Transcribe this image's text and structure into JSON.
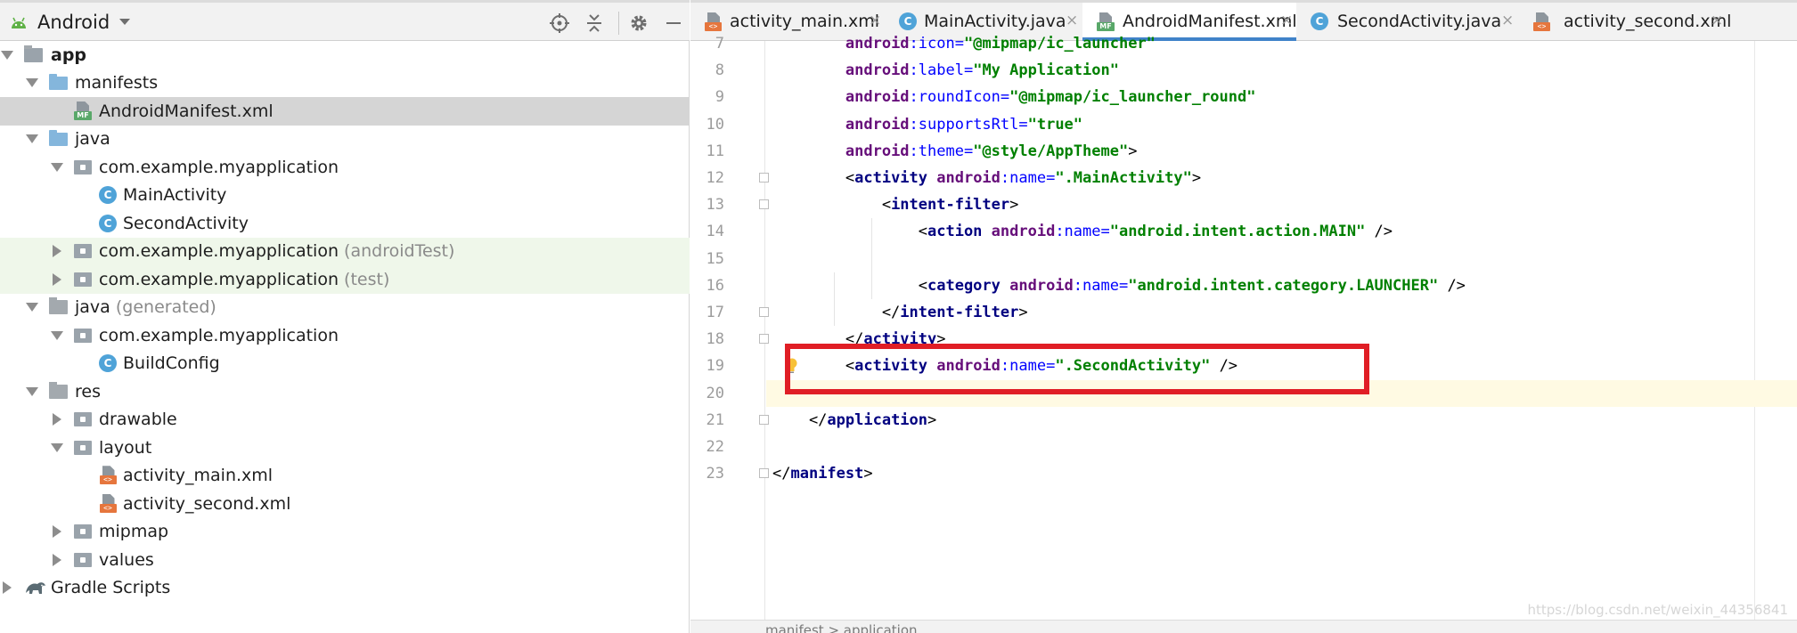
{
  "project_panel": {
    "view_mode": "Android",
    "header_icons": [
      "locate-icon",
      "collapse-all-icon",
      "gear-icon",
      "hide-icon"
    ],
    "tree": [
      {
        "label": "app",
        "bold": true,
        "icon": "module-folder-icon",
        "expanded": true
      },
      {
        "label": "manifests",
        "icon": "folder-icon",
        "expanded": true
      },
      {
        "label": "AndroidManifest.xml",
        "icon": "manifest-file-icon",
        "selected": true
      },
      {
        "label": "java",
        "icon": "folder-icon",
        "expanded": true
      },
      {
        "label": "com.example.myapplication",
        "icon": "package-icon",
        "expanded": true
      },
      {
        "label": "MainActivity",
        "icon": "class-icon"
      },
      {
        "label": "SecondActivity",
        "icon": "class-icon"
      },
      {
        "label": "com.example.myapplication",
        "suffix": "(androidTest)",
        "icon": "package-icon",
        "expanded": false
      },
      {
        "label": "com.example.myapplication",
        "suffix": "(test)",
        "icon": "package-icon",
        "expanded": false
      },
      {
        "label": "java",
        "suffix": "(generated)",
        "icon": "generated-folder-icon",
        "expanded": true
      },
      {
        "label": "com.example.myapplication",
        "icon": "package-icon",
        "expanded": true
      },
      {
        "label": "BuildConfig",
        "icon": "class-icon"
      },
      {
        "label": "res",
        "icon": "res-folder-icon",
        "expanded": true
      },
      {
        "label": "drawable",
        "icon": "folder-icon",
        "expanded": false
      },
      {
        "label": "layout",
        "icon": "folder-icon",
        "expanded": true
      },
      {
        "label": "activity_main.xml",
        "icon": "xml-file-icon"
      },
      {
        "label": "activity_second.xml",
        "icon": "xml-file-icon"
      },
      {
        "label": "mipmap",
        "icon": "folder-icon",
        "expanded": false
      },
      {
        "label": "values",
        "icon": "folder-icon",
        "expanded": false
      },
      {
        "label": "Gradle Scripts",
        "icon": "gradle-icon",
        "expanded": false
      }
    ]
  },
  "editor": {
    "tabs": [
      {
        "label": "activity_main.xml",
        "icon": "xml-file-icon",
        "active": false
      },
      {
        "label": "MainActivity.java",
        "icon": "class-icon",
        "active": false
      },
      {
        "label": "AndroidManifest.xml",
        "icon": "manifest-file-icon",
        "active": true
      },
      {
        "label": "SecondActivity.java",
        "icon": "class-icon",
        "active": false
      },
      {
        "label": "activity_second.xml",
        "icon": "xml-file-icon",
        "active": false
      }
    ],
    "tab_close_glyph": "×",
    "lines": [
      {
        "num": "7",
        "tokens": [
          [
            "plain",
            "        "
          ],
          [
            "ns",
            "android"
          ],
          [
            "attr",
            ":icon="
          ],
          [
            "val",
            "\"@mipmap/ic_launcher\""
          ]
        ]
      },
      {
        "num": "8",
        "tokens": [
          [
            "plain",
            "        "
          ],
          [
            "ns",
            "android"
          ],
          [
            "attr",
            ":label="
          ],
          [
            "val",
            "\"My Application\""
          ]
        ]
      },
      {
        "num": "9",
        "tokens": [
          [
            "plain",
            "        "
          ],
          [
            "ns",
            "android"
          ],
          [
            "attr",
            ":roundIcon="
          ],
          [
            "val",
            "\"@mipmap/ic_launcher_round\""
          ]
        ]
      },
      {
        "num": "10",
        "tokens": [
          [
            "plain",
            "        "
          ],
          [
            "ns",
            "android"
          ],
          [
            "attr",
            ":supportsRtl="
          ],
          [
            "val",
            "\"true\""
          ]
        ]
      },
      {
        "num": "11",
        "tokens": [
          [
            "plain",
            "        "
          ],
          [
            "ns",
            "android"
          ],
          [
            "attr",
            ":theme="
          ],
          [
            "val",
            "\"@style/AppTheme\""
          ],
          [
            "plain",
            ">"
          ]
        ]
      },
      {
        "num": "12",
        "tokens": [
          [
            "plain",
            "        <"
          ],
          [
            "tag",
            "activity "
          ],
          [
            "ns",
            "android"
          ],
          [
            "attr",
            ":name="
          ],
          [
            "val",
            "\".MainActivity\""
          ],
          [
            "plain",
            ">"
          ]
        ]
      },
      {
        "num": "13",
        "tokens": [
          [
            "plain",
            "            <"
          ],
          [
            "tag",
            "intent-filter"
          ],
          [
            "plain",
            ">"
          ]
        ]
      },
      {
        "num": "14",
        "tokens": [
          [
            "plain",
            "                <"
          ],
          [
            "tag",
            "action "
          ],
          [
            "ns",
            "android"
          ],
          [
            "attr",
            ":name="
          ],
          [
            "val",
            "\"android.intent.action.MAIN\""
          ],
          [
            "plain",
            " />"
          ]
        ]
      },
      {
        "num": "15",
        "tokens": []
      },
      {
        "num": "16",
        "tokens": [
          [
            "plain",
            "                <"
          ],
          [
            "tag",
            "category "
          ],
          [
            "ns",
            "android"
          ],
          [
            "attr",
            ":name="
          ],
          [
            "val",
            "\"android.intent.category.LAUNCHER\""
          ],
          [
            "plain",
            " />"
          ]
        ]
      },
      {
        "num": "17",
        "tokens": [
          [
            "plain",
            "            </"
          ],
          [
            "tag",
            "intent-filter"
          ],
          [
            "plain",
            ">"
          ]
        ]
      },
      {
        "num": "18",
        "tokens": [
          [
            "plain",
            "        </"
          ],
          [
            "tag",
            "activity"
          ],
          [
            "plain",
            ">"
          ]
        ]
      },
      {
        "num": "19",
        "tokens": [
          [
            "plain",
            "        <"
          ],
          [
            "tag",
            "activity "
          ],
          [
            "ns",
            "android"
          ],
          [
            "attr",
            ":name="
          ],
          [
            "val",
            "\".SecondActivity\""
          ],
          [
            "plain",
            " />"
          ]
        ]
      },
      {
        "num": "20",
        "tokens": []
      },
      {
        "num": "21",
        "tokens": [
          [
            "plain",
            "    </"
          ],
          [
            "tag",
            "application"
          ],
          [
            "plain",
            ">"
          ]
        ]
      },
      {
        "num": "22",
        "tokens": []
      },
      {
        "num": "23",
        "tokens": [
          [
            "plain",
            "</"
          ],
          [
            "tag",
            "manifest"
          ],
          [
            "plain",
            ">"
          ]
        ]
      }
    ],
    "caret_line": "20",
    "breadcrumb": "manifest  >  application",
    "watermark": "https://blog.csdn.net/weixin_44356841",
    "highlight_color": "#e01e25"
  }
}
